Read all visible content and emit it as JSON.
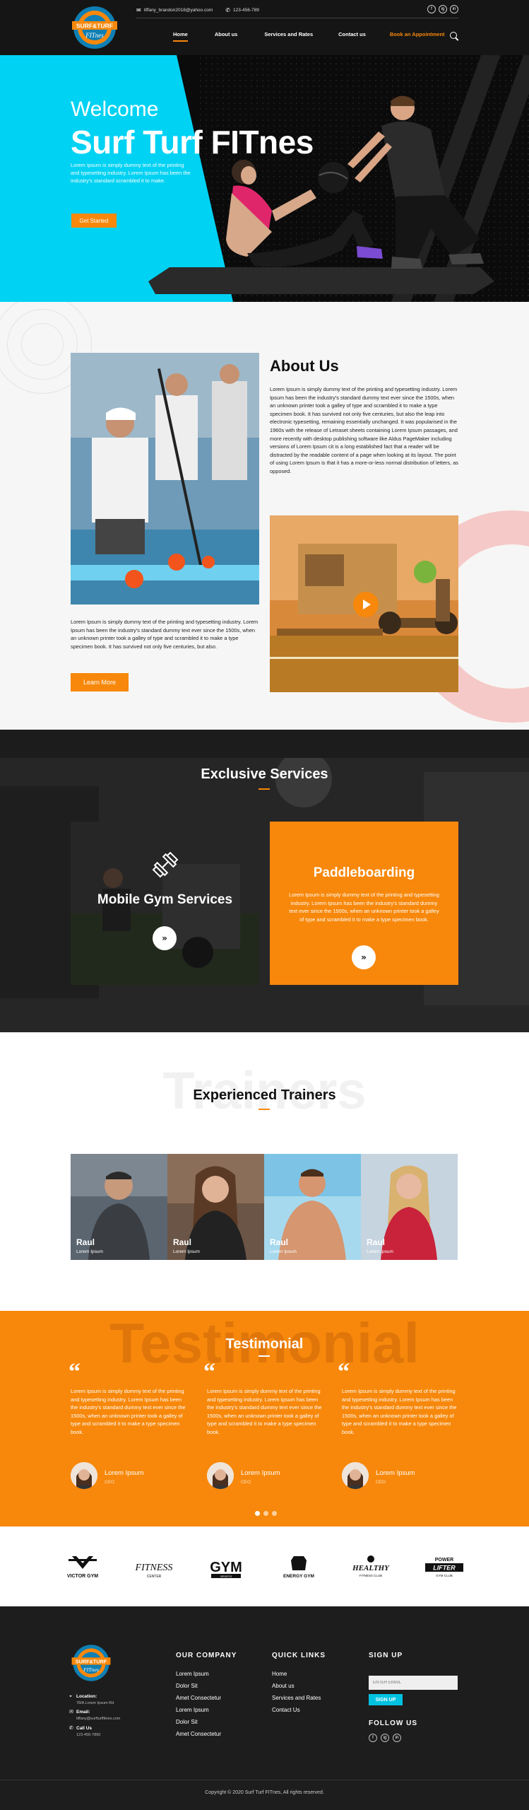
{
  "header": {
    "logo_text_top": "SURF&TURF",
    "logo_text_bottom": "FITnes",
    "email": "tiffany_brandon2018@yahoo.com",
    "phone": "123-456-789",
    "social": [
      "f",
      "ig",
      "in"
    ],
    "nav": [
      {
        "label": "Home"
      },
      {
        "label": "About us"
      },
      {
        "label": "Services and Rates"
      },
      {
        "label": "Contact us"
      },
      {
        "label": "Book an Appointment"
      }
    ]
  },
  "hero": {
    "welcome": "Welcome",
    "title": "Surf Turf FITnes",
    "text": "Lorem Ipsum is simply dummy text of the printing and typesetting industry. Lorem Ipsum has been the industry's standard scrambled it to make.",
    "cta": "Get Started"
  },
  "about": {
    "title": "About Us",
    "text1": "Lorem Ipsum is simply dummy text of the printing and typesetting industry. Lorem Ipsum has been the industry's standard dummy text ever since the 1500s, when an unknown printer took a galley of type and scrambled it to make a type specimen book. It has survived not only five centuries, but also the leap into electronic typesetting, remaining essentially unchanged. It was popularised in the 1960s with the release of Letraset sheets containing Lorem Ipsum passages, and more recently with desktop publishing software like Aldus PageMaker including versions of Lorem Ipsum cit is a long established fact that a reader will be distracted by the readable content of a page when looking at its layout. The point of using Lorem Ipsum is that it has a more-or-less normal distribution of letters, as opposed.",
    "text2": "Lorem Ipsum is simply dummy text of the printing and typesetting industry. Lorem Ipsum has been the industry's standard dummy text ever since the 1500s, when an unknown printer took a galley of type and scrambled it to make a type specimen book. It has survived not only five centuries, but also.",
    "cta": "Learn More"
  },
  "services": {
    "title": "Exclusive Services",
    "cards": [
      {
        "title": "Mobile Gym Services"
      },
      {
        "title": "Paddleboarding",
        "text": "Lorem Ipsum is simply dummy text of the printing and typesetting industry. Lorem Ipsum has been the industry's standard dummy text ever since the 1500s, when an unknown printer took a galley of type and scrambled it to make a type specimen book."
      }
    ],
    "arrow": "»"
  },
  "trainers": {
    "watermark": "Trainers",
    "title": "Experienced Trainers",
    "items": [
      {
        "name": "Raul",
        "role": "Lorem Ipsum"
      },
      {
        "name": "Raul",
        "role": "Lorem Ipsum"
      },
      {
        "name": "Raul",
        "role": "Lorem Ipsum"
      },
      {
        "name": "Raul",
        "role": "Lorem Ipsum"
      }
    ]
  },
  "testimonial": {
    "watermark": "Testimonial",
    "title": "Testimonial",
    "quote_mark": "“",
    "items": [
      {
        "text": "Lorem Ipsum is simply dummy text of the printing and typesetting industry. Lorem Ipsum has been the industry's standard dummy text ever since the 1500s, when an unknown printer took a galley of type and scrambled it to make a type specimen book.",
        "name": "Lorem Ipsum",
        "role": "CEO"
      },
      {
        "text": "Lorem Ipsum is simply dummy text of the printing and typesetting industry. Lorem Ipsum has been the industry's standard dummy text ever since the 1500s, when an unknown printer took a galley of type and scrambled it to make a type specimen book.",
        "name": "Lorem Ipsum",
        "role": "CEO"
      },
      {
        "text": "Lorem Ipsum is simply dummy text of the printing and typesetting industry. Lorem Ipsum has been the industry's standard dummy text ever since the 1500s, when an unknown printer took a galley of type and scrambled it to make a type specimen book.",
        "name": "Lorem Ipsum",
        "role": "CEO"
      }
    ]
  },
  "brands": [
    {
      "name": "VICTOR GYM"
    },
    {
      "name": "FITNESS",
      "sub": "CENTER"
    },
    {
      "name": "GYM",
      "sub": "SPORTS"
    },
    {
      "name": "ENERGY GYM"
    },
    {
      "name": "HEALTHY",
      "sub": "FITNESS CLUB"
    },
    {
      "name": "POWER",
      "mid": "LIFTER",
      "sub": "GYM CLUB"
    }
  ],
  "footer": {
    "location_label": "Location:",
    "location_value": "78/A Lorem Ipsum Rd",
    "email_label": "Email:",
    "email_value": "tiffany@surfturffitnes.com",
    "phone_label": "Call Us",
    "phone_value": "123-456-7890",
    "company_title": "OUR COMPANY",
    "company_links": [
      "Lorem Ipsum",
      "Dolor Sit",
      "Amet Consectetur",
      "Lorem Ipsum",
      "Dolor Sit",
      "Amet Consectetur"
    ],
    "quick_title": "QUICK LINKS",
    "quick_links": [
      "Home",
      "About us",
      "Services and Rates",
      "Contact Us"
    ],
    "signup_title": "SIGN UP",
    "email_placeholder": "ENTER EMAIL",
    "signup_button": "SIGN UP",
    "follow_title": "FOLLOW US",
    "copyright": "Copyright © 2020 Surf Turf FITnes, All rights reserved."
  },
  "colors": {
    "accent": "#f7880b",
    "cyan": "#00d2f3",
    "dark": "#151515"
  }
}
